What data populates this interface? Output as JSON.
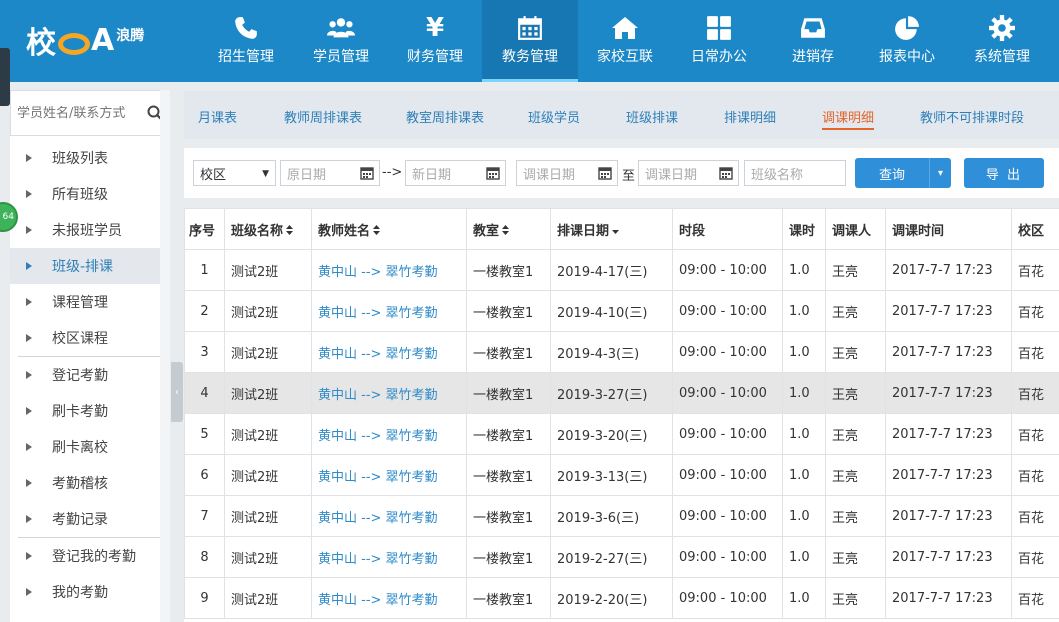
{
  "app": {
    "logo_main": "校",
    "logo_a": "A",
    "logo_sub": "浪腾"
  },
  "nav": [
    {
      "label": "招生管理",
      "icon": "phone-icon"
    },
    {
      "label": "学员管理",
      "icon": "users-icon"
    },
    {
      "label": "财务管理",
      "icon": "yen-icon"
    },
    {
      "label": "教务管理",
      "icon": "calendar-icon",
      "active": true
    },
    {
      "label": "家校互联",
      "icon": "home-icon"
    },
    {
      "label": "日常办公",
      "icon": "grid-icon"
    },
    {
      "label": "进销存",
      "icon": "inbox-icon"
    },
    {
      "label": "报表中心",
      "icon": "pie-chart-icon"
    },
    {
      "label": "系统管理",
      "icon": "gear-icon"
    }
  ],
  "edge_badge": "64",
  "sidebar": {
    "search_placeholder": "学员姓名/联系方式",
    "items": [
      "班级列表",
      "所有班级",
      "未报班学员",
      "班级-排课",
      "课程管理",
      "校区课程",
      "登记考勤",
      "刷卡考勤",
      "刷卡离校",
      "考勤稽核",
      "考勤记录",
      "登记我的考勤",
      "我的考勤"
    ],
    "active_index": 3
  },
  "subtabs": [
    "月课表",
    "教师周排课表",
    "教室周排课表",
    "班级学员",
    "班级排课",
    "排课明细",
    "调课明细",
    "教师不可排课时段"
  ],
  "subtab_active": 6,
  "filters": {
    "campus": "校区",
    "orig_date_placeholder": "原日期",
    "arrow": "-->",
    "new_date_placeholder": "新日期",
    "adj_date_from_placeholder": "调课日期",
    "to": "至",
    "adj_date_to_placeholder": "调课日期",
    "class_name_placeholder": "班级名称",
    "query_label": "查询",
    "export_label": "导 出"
  },
  "table": {
    "headers": [
      "序号",
      "班级名称",
      "教师姓名",
      "教室",
      "排课日期",
      "时段",
      "课时",
      "调课人",
      "调课时间",
      "校区"
    ],
    "rows": [
      [
        "1",
        "测试2班",
        "黄中山 --> 翠竹考勤",
        "一楼教室1",
        "2019-4-17(三)",
        "09:00 - 10:00",
        "1.0",
        "王亮",
        "2017-7-7 17:23",
        "百花"
      ],
      [
        "2",
        "测试2班",
        "黄中山 --> 翠竹考勤",
        "一楼教室1",
        "2019-4-10(三)",
        "09:00 - 10:00",
        "1.0",
        "王亮",
        "2017-7-7 17:23",
        "百花"
      ],
      [
        "3",
        "测试2班",
        "黄中山 --> 翠竹考勤",
        "一楼教室1",
        "2019-4-3(三)",
        "09:00 - 10:00",
        "1.0",
        "王亮",
        "2017-7-7 17:23",
        "百花"
      ],
      [
        "4",
        "测试2班",
        "黄中山 --> 翠竹考勤",
        "一楼教室1",
        "2019-3-27(三)",
        "09:00 - 10:00",
        "1.0",
        "王亮",
        "2017-7-7 17:23",
        "百花"
      ],
      [
        "5",
        "测试2班",
        "黄中山 --> 翠竹考勤",
        "一楼教室1",
        "2019-3-20(三)",
        "09:00 - 10:00",
        "1.0",
        "王亮",
        "2017-7-7 17:23",
        "百花"
      ],
      [
        "6",
        "测试2班",
        "黄中山 --> 翠竹考勤",
        "一楼教室1",
        "2019-3-13(三)",
        "09:00 - 10:00",
        "1.0",
        "王亮",
        "2017-7-7 17:23",
        "百花"
      ],
      [
        "7",
        "测试2班",
        "黄中山 --> 翠竹考勤",
        "一楼教室1",
        "2019-3-6(三)",
        "09:00 - 10:00",
        "1.0",
        "王亮",
        "2017-7-7 17:23",
        "百花"
      ],
      [
        "8",
        "测试2班",
        "黄中山 --> 翠竹考勤",
        "一楼教室1",
        "2019-2-27(三)",
        "09:00 - 10:00",
        "1.0",
        "王亮",
        "2017-7-7 17:23",
        "百花"
      ],
      [
        "9",
        "测试2班",
        "黄中山 --> 翠竹考勤",
        "一楼教室1",
        "2019-2-20(三)",
        "09:00 - 10:00",
        "1.0",
        "王亮",
        "2017-7-7 17:23",
        "百花"
      ]
    ],
    "highlight_row": 3
  }
}
